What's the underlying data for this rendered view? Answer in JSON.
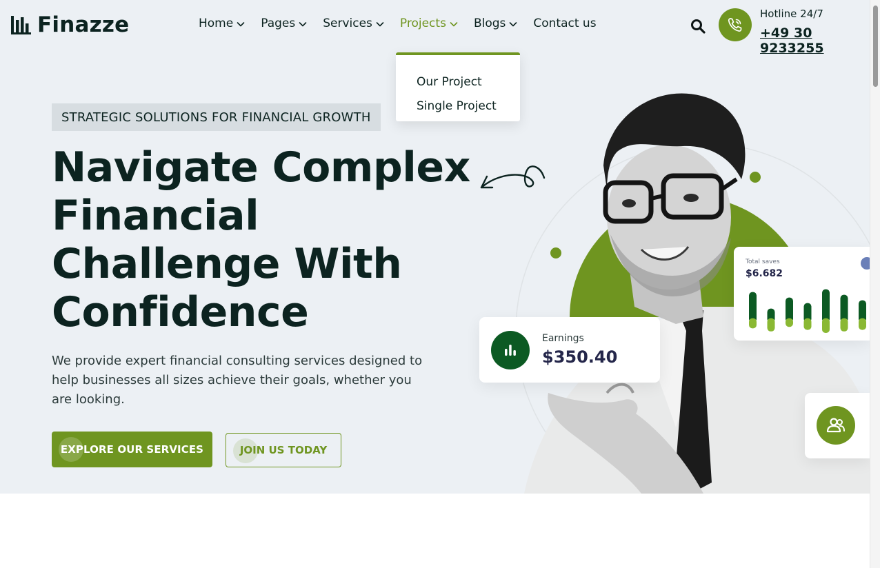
{
  "brand": {
    "name": "Finazze"
  },
  "nav": {
    "items": [
      {
        "label": "Home",
        "has_dropdown": true,
        "active": false
      },
      {
        "label": "Pages",
        "has_dropdown": true,
        "active": false
      },
      {
        "label": "Services",
        "has_dropdown": true,
        "active": false
      },
      {
        "label": "Projects",
        "has_dropdown": true,
        "active": true
      },
      {
        "label": "Blogs",
        "has_dropdown": true,
        "active": false
      },
      {
        "label": "Contact us",
        "has_dropdown": false,
        "active": false
      }
    ],
    "dropdown": {
      "parent": "Projects",
      "items": [
        "Our Project",
        "Single Project"
      ]
    }
  },
  "header": {
    "search_icon": "search-icon",
    "phone_icon": "phone-icon",
    "hotline_label": "Hotline 24/7",
    "hotline_number": "+49 30 9233255"
  },
  "hero": {
    "tagline": "STRATEGIC SOLUTIONS FOR FINANCIAL GROWTH",
    "headline_lines": [
      "Navigate Complex",
      "Financial",
      "Challenge With",
      "Confidence"
    ],
    "lead": "We provide expert financial consulting services designed to help businesses all sizes achieve their goals, whether you are looking.",
    "primary_cta": "EXPLORE OUR SERVICES",
    "secondary_cta": "JOIN US TODAY"
  },
  "widgets": {
    "earnings": {
      "label": "Earnings",
      "value": "$350.40",
      "icon": "bar-chart-icon"
    },
    "savings": {
      "label": "Total saves",
      "value": "$6.682",
      "bars": [
        {
          "dark": 0.55,
          "light": 0.2
        },
        {
          "dark": 0.25,
          "light": 0.3
        },
        {
          "dark": 0.45,
          "light": 0.15
        },
        {
          "dark": 0.35,
          "light": 0.25
        },
        {
          "dark": 0.6,
          "light": 0.35
        },
        {
          "dark": 0.5,
          "light": 0.3
        },
        {
          "dark": 0.4,
          "light": 0.25
        }
      ]
    },
    "team": {
      "icon": "users-icon"
    }
  },
  "colors": {
    "brand_green": "#6f9520",
    "dark_green": "#0c5a23",
    "ink": "#0c2320",
    "hero_bg": "#ecf0f4",
    "tagline_bg": "#d7dde1"
  }
}
